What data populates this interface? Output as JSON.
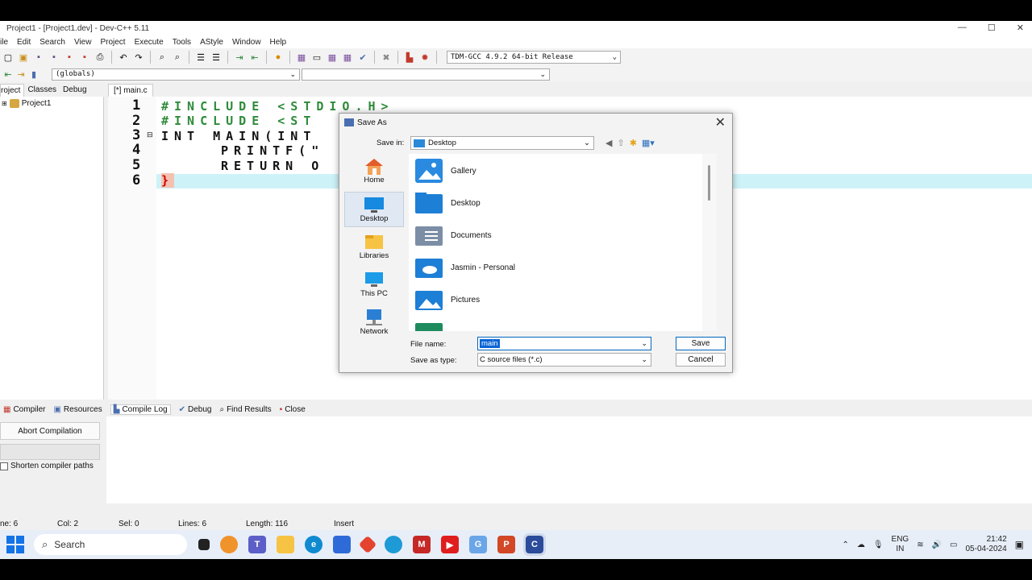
{
  "window": {
    "title": "Project1 - [Project1.dev] - Dev-C++ 5.11"
  },
  "menu": [
    "ile",
    "Edit",
    "Search",
    "View",
    "Project",
    "Execute",
    "Tools",
    "AStyle",
    "Window",
    "Help"
  ],
  "toolbar": {
    "compiler": "TDM-GCC 4.9.2 64-bit Release",
    "scope": "(globals)"
  },
  "left_panel": {
    "tabs": [
      "roject",
      "Classes",
      "Debug"
    ],
    "project_name": "Project1"
  },
  "editor": {
    "tab": "[*] main.c",
    "line_numbers": [
      "1",
      "2",
      "3",
      "4",
      "5",
      "6"
    ],
    "lines": [
      "#INCLUDE <STDIO.H>",
      "#INCLUDE <ST",
      "INT MAIN(INT",
      "PRINTF(\"",
      "RETURN O",
      "}"
    ]
  },
  "bottom_tabs": [
    "Compiler",
    "Resources",
    "Compile Log",
    "Debug",
    "Find Results",
    "Close"
  ],
  "bottom_panel": {
    "abort_label": "Abort Compilation",
    "shorten_label": "Shorten compiler paths"
  },
  "status": {
    "line": "ne:   6",
    "col": "Col:   2",
    "sel": "Sel:   0",
    "lines": "Lines:   6",
    "length": "Length:  116",
    "mode": "Insert"
  },
  "dialog": {
    "title": "Save As",
    "save_in_label": "Save in:",
    "save_in_value": "Desktop",
    "places": [
      "Home",
      "Desktop",
      "Libraries",
      "This PC",
      "Network"
    ],
    "items": [
      "Gallery",
      "Desktop",
      "Documents",
      "Jasmin - Personal",
      "Pictures"
    ],
    "file_name_label": "File name:",
    "file_name_value": "main",
    "save_type_label": "Save as type:",
    "save_type_value": "C source files (*.c)",
    "save_button": "Save",
    "cancel_button": "Cancel"
  },
  "taskbar": {
    "search": "Search",
    "lang1": "ENG",
    "lang2": "IN",
    "time": "21:42",
    "date": "05-04-2024"
  },
  "colors": {
    "accent": "#0a64d6",
    "highlight_line": "#cdf3f8",
    "taskbar": "#e7eef8"
  }
}
